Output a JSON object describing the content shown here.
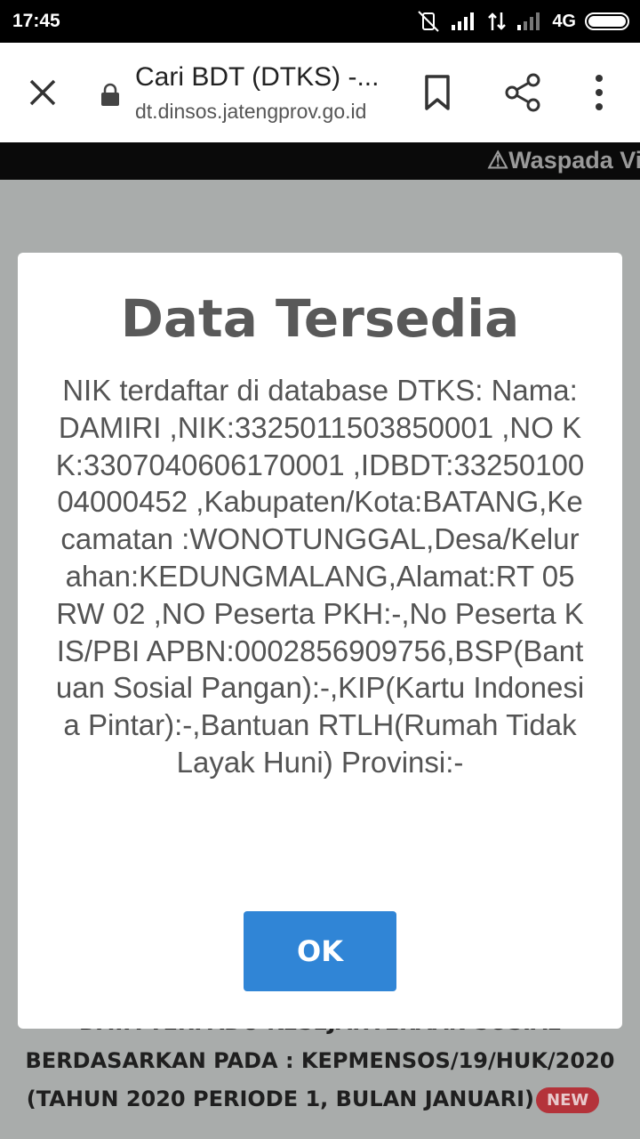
{
  "status_bar": {
    "time": "17:45",
    "network": "4G"
  },
  "toolbar": {
    "title": "Cari BDT (DTKS) -...",
    "url": "dt.dinsos.jatengprov.go.id"
  },
  "marquee": {
    "text": "⚠Waspada Vi"
  },
  "background": {
    "line1": "DATA TERPADU KESEJAHTERAAN SOSIAL",
    "line2": "BERDASARKAN PADA : KEPMENSOS/19/HUK/2020",
    "line3": "(TAHUN 2020 PERIODE 1, BULAN JANUARI)",
    "badge": "NEW"
  },
  "modal": {
    "title": "Data Tersedia",
    "body": "NIK terdaftar di database DTKS: Nama:DAMIRI ,NIK:3325011503850001 ,NO KK:3307040606170001 ,IDBDT:3325010004000452 ,Kabupaten/Kota:BATANG,Kecamatan :WONOTUNGGAL,Desa/Kelurahan:KEDUNGMALANG,Alamat:RT 05 RW 02 ,NO Peserta PKH:-,No Peserta KIS/PBI APBN:0002856909756,BSP(Bantuan Sosial Pangan):-,KIP(Kartu Indonesia Pintar):-,Bantuan RTLH(Rumah Tidak Layak Huni) Provinsi:-",
    "ok_label": "OK"
  },
  "colors": {
    "ok_button": "#3085d6",
    "badge": "#b4333a",
    "overlay": "#a9acab"
  }
}
